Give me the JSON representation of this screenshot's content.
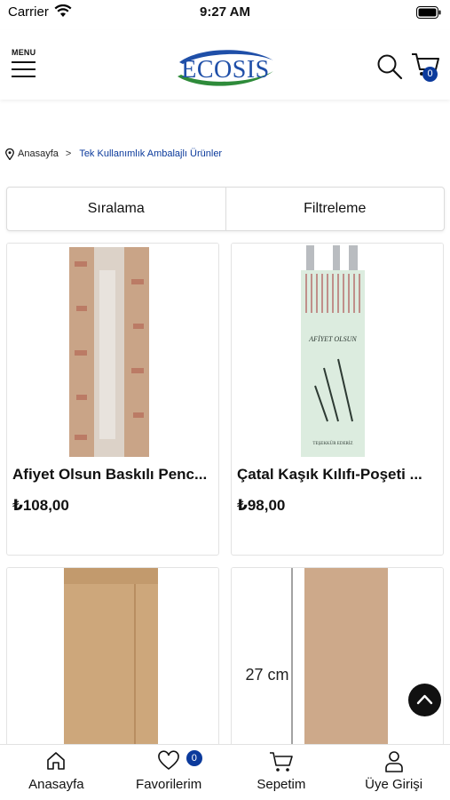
{
  "status_bar": {
    "carrier": "Carrier",
    "time": "9:27 AM"
  },
  "header": {
    "menu_label": "MENU",
    "logo_text": "ECOSIS",
    "cart_count": "0"
  },
  "breadcrumb": {
    "home": "Anasayfa",
    "separator": ">",
    "current": "Tek Kullanımlık Ambalajlı Ürünler"
  },
  "toolbar": {
    "sort_label": "Sıralama",
    "filter_label": "Filtreleme"
  },
  "products": [
    {
      "title": "Afiyet Olsun Baskılı Penc...",
      "price": "₺108,00"
    },
    {
      "title": "Çatal Kaşık Kılıfı-Poşeti ...",
      "price": "₺98,00"
    },
    {
      "title": "",
      "price": ""
    },
    {
      "title": "",
      "price": "",
      "image_caption": "27 cm"
    }
  ],
  "product_images": {
    "sleeve_text_top": "AFİYET OLSUN",
    "sleeve_text_bottom": "TEŞEKKÜR EDERİZ"
  },
  "tabbar": {
    "home": "Anasayfa",
    "favorites": "Favorilerim",
    "favorites_count": "0",
    "cart": "Sepetim",
    "login": "Üye Girişi"
  },
  "colors": {
    "brand_blue": "#0b3a9c",
    "logo_green": "#2e8b3a",
    "kraft": "#c7a27a"
  },
  "icons": [
    "wifi-icon",
    "battery-icon",
    "menu-icon",
    "search-icon",
    "cart-icon",
    "location-pin-icon",
    "arrow-up-icon",
    "home-icon",
    "heart-icon",
    "cart-icon",
    "user-icon"
  ]
}
